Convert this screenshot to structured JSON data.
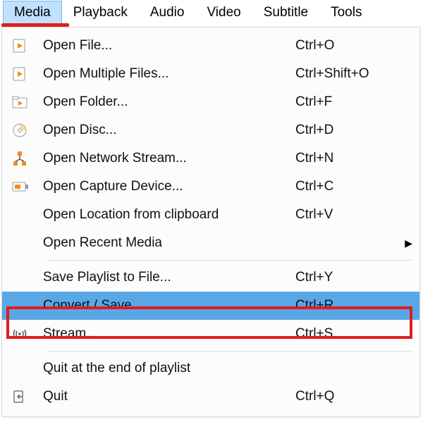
{
  "menubar": {
    "items": [
      {
        "label": "Media",
        "active": true
      },
      {
        "label": "Playback"
      },
      {
        "label": "Audio"
      },
      {
        "label": "Video"
      },
      {
        "label": "Subtitle"
      },
      {
        "label": "Tools"
      }
    ]
  },
  "dropdown": {
    "items": [
      {
        "icon": "file-play-icon",
        "label": "Open File...",
        "shortcut": "Ctrl+O"
      },
      {
        "icon": "file-play-icon",
        "label": "Open Multiple Files...",
        "shortcut": "Ctrl+Shift+O"
      },
      {
        "icon": "folder-play-icon",
        "label": "Open Folder...",
        "shortcut": "Ctrl+F"
      },
      {
        "icon": "disc-icon",
        "label": "Open Disc...",
        "shortcut": "Ctrl+D"
      },
      {
        "icon": "network-icon",
        "label": "Open Network Stream...",
        "shortcut": "Ctrl+N"
      },
      {
        "icon": "capture-device-icon",
        "label": "Open Capture Device...",
        "shortcut": "Ctrl+C"
      },
      {
        "icon": "",
        "label": "Open Location from clipboard",
        "shortcut": "Ctrl+V"
      },
      {
        "icon": "",
        "label": "Open Recent Media",
        "shortcut": "",
        "submenu": true
      },
      {
        "divider": true
      },
      {
        "icon": "",
        "label": "Save Playlist to File...",
        "shortcut": "Ctrl+Y"
      },
      {
        "icon": "",
        "label": "Convert / Save...",
        "shortcut": "Ctrl+R",
        "highlighted": true
      },
      {
        "icon": "stream-icon",
        "label": "Stream...",
        "shortcut": "Ctrl+S"
      },
      {
        "divider": true
      },
      {
        "icon": "",
        "label": "Quit at the end of playlist",
        "shortcut": ""
      },
      {
        "icon": "quit-icon",
        "label": "Quit",
        "shortcut": "Ctrl+Q"
      }
    ]
  }
}
